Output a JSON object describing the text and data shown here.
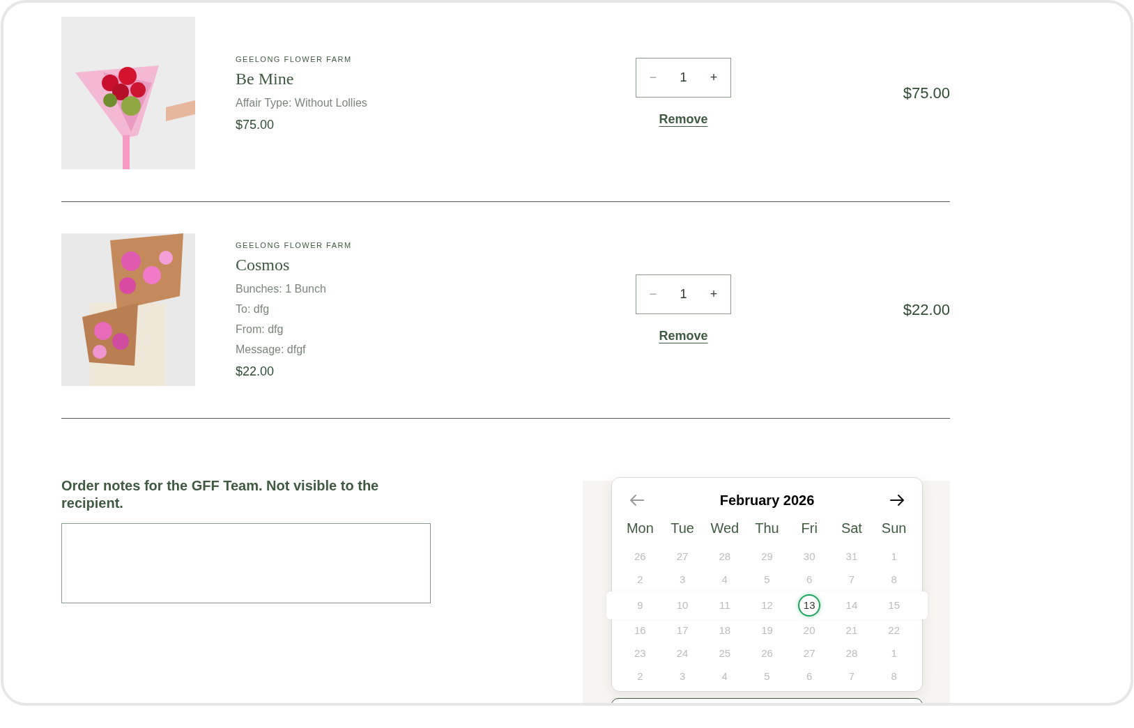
{
  "cart_items": [
    {
      "vendor": "GEELONG FLOWER FARM",
      "title": "Be Mine",
      "options": [
        "Affair Type: Without Lollies"
      ],
      "unit_price": "$75.00",
      "quantity": "1",
      "decrease": "−",
      "increase": "+",
      "remove": "Remove",
      "line_total": "$75.00",
      "image": {
        "kind": "picture"
      }
    },
    {
      "vendor": "GEELONG FLOWER FARM",
      "title": "Cosmos",
      "options": [
        "Bunches: 1 Bunch",
        "To: dfg",
        "From: dfg",
        "Message: dfgf"
      ],
      "unit_price": "$22.00",
      "quantity": "1",
      "decrease": "−",
      "increase": "+",
      "remove": "Remove",
      "line_total": "$22.00",
      "image": {
        "kind": "picture"
      }
    }
  ],
  "order_notes": {
    "label": "Order notes for the GFF Team. Not visible to the recipient."
  },
  "calendar": {
    "month": "February 2026",
    "prev_button": {
      "disabled": true
    },
    "next_button": {
      "disabled": false
    },
    "weekdays": [
      "Mon",
      "Tue",
      "Wed",
      "Thu",
      "Fri",
      "Sat",
      "Sun"
    ],
    "weeks": [
      {
        "highlighted": false,
        "days": [
          {
            "label": "26",
            "selected": false,
            "disabled": true
          },
          {
            "label": "27",
            "selected": false,
            "disabled": true
          },
          {
            "label": "28",
            "selected": false,
            "disabled": true
          },
          {
            "label": "29",
            "selected": false,
            "disabled": true
          },
          {
            "label": "30",
            "selected": false,
            "disabled": true
          },
          {
            "label": "31",
            "selected": false,
            "disabled": true
          },
          {
            "label": "1",
            "selected": false,
            "disabled": true
          }
        ]
      },
      {
        "highlighted": false,
        "days": [
          {
            "label": "2",
            "selected": false,
            "disabled": true
          },
          {
            "label": "3",
            "selected": false,
            "disabled": true
          },
          {
            "label": "4",
            "selected": false,
            "disabled": true
          },
          {
            "label": "5",
            "selected": false,
            "disabled": true
          },
          {
            "label": "6",
            "selected": false,
            "disabled": true
          },
          {
            "label": "7",
            "selected": false,
            "disabled": true
          },
          {
            "label": "8",
            "selected": false,
            "disabled": true
          }
        ]
      },
      {
        "highlighted": true,
        "days": [
          {
            "label": "9",
            "selected": false,
            "disabled": true
          },
          {
            "label": "10",
            "selected": false,
            "disabled": true
          },
          {
            "label": "11",
            "selected": false,
            "disabled": true
          },
          {
            "label": "12",
            "selected": false,
            "disabled": true
          },
          {
            "label": "13",
            "selected": true,
            "disabled": false
          },
          {
            "label": "14",
            "selected": false,
            "disabled": true
          },
          {
            "label": "15",
            "selected": false,
            "disabled": true
          }
        ]
      },
      {
        "highlighted": false,
        "days": [
          {
            "label": "16",
            "selected": false,
            "disabled": true
          },
          {
            "label": "17",
            "selected": false,
            "disabled": true
          },
          {
            "label": "18",
            "selected": false,
            "disabled": true
          },
          {
            "label": "19",
            "selected": false,
            "disabled": true
          },
          {
            "label": "20",
            "selected": false,
            "disabled": true
          },
          {
            "label": "21",
            "selected": false,
            "disabled": true
          },
          {
            "label": "22",
            "selected": false,
            "disabled": true
          }
        ]
      },
      {
        "highlighted": false,
        "days": [
          {
            "label": "23",
            "selected": false,
            "disabled": true
          },
          {
            "label": "24",
            "selected": false,
            "disabled": true
          },
          {
            "label": "25",
            "selected": false,
            "disabled": true
          },
          {
            "label": "26",
            "selected": false,
            "disabled": true
          },
          {
            "label": "27",
            "selected": false,
            "disabled": true
          },
          {
            "label": "28",
            "selected": false,
            "disabled": true
          },
          {
            "label": "1",
            "selected": false,
            "disabled": true
          }
        ]
      },
      {
        "highlighted": false,
        "days": [
          {
            "label": "2",
            "selected": false,
            "disabled": true
          },
          {
            "label": "3",
            "selected": false,
            "disabled": true
          },
          {
            "label": "4",
            "selected": false,
            "disabled": true
          },
          {
            "label": "5",
            "selected": false,
            "disabled": true
          },
          {
            "label": "6",
            "selected": false,
            "disabled": true
          },
          {
            "label": "7",
            "selected": false,
            "disabled": true
          },
          {
            "label": "8",
            "selected": false,
            "disabled": true
          }
        ]
      }
    ]
  }
}
